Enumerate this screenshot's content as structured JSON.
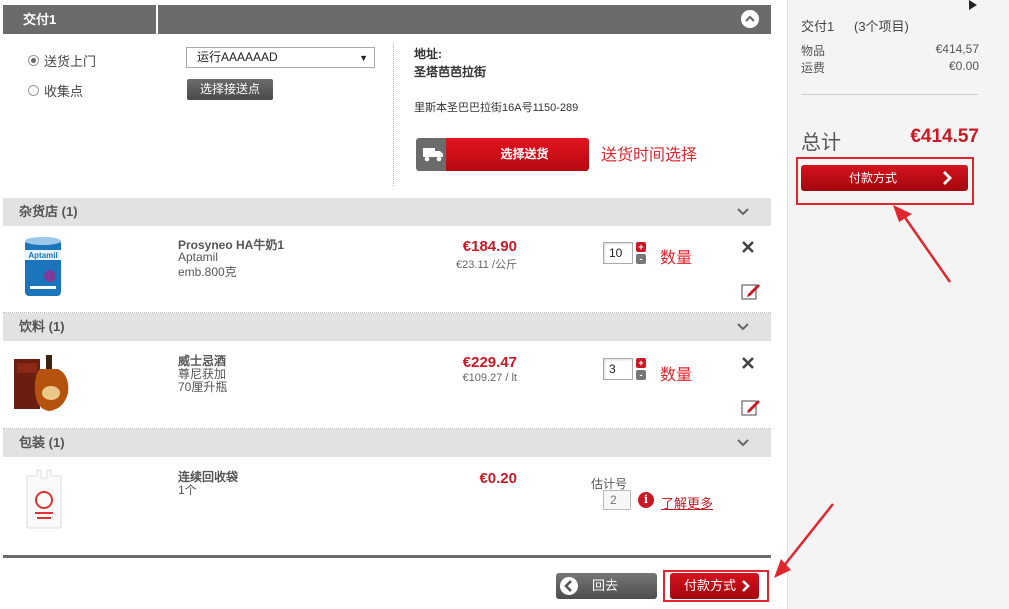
{
  "header": {
    "title": "交付1"
  },
  "delivery": {
    "option_home": "送货上门",
    "option_pickup": "收集点",
    "select_value": "运行AAAAAAD",
    "pickup_btn": "选择接送点",
    "address_label": "地址:",
    "address_name": "圣塔芭芭拉街",
    "address_line": "里斯本圣巴巴拉街16A号1150-289",
    "choose_delivery_btn": "选择送货",
    "delivery_time_annotation": "送货时间选择"
  },
  "sections": [
    {
      "name": "杂货店",
      "count": "(1)",
      "item": {
        "name": "Prosyneo HA牛奶1",
        "brand": "Aptamil",
        "detail": "emb.800克",
        "price": "€184.90",
        "unit": "€23.11 /公斤",
        "qty": "10",
        "qty_label": "数量",
        "image_label": "Aptamil"
      }
    },
    {
      "name": "饮料",
      "count": "(1)",
      "item": {
        "name": "威士忌酒",
        "brand": "尊尼获加",
        "detail": "70厘升瓶",
        "price": "€229.47",
        "unit": "€109.27 / lt",
        "qty": "3",
        "qty_label": "数量"
      }
    },
    {
      "name": "包装",
      "count": "(1)",
      "item": {
        "name": "连续回收袋",
        "brand": "1个",
        "price": "€0.20",
        "estimate_label": "估计号",
        "estimate_value": "2",
        "info_glyph": "i",
        "learn_more": "了解更多"
      }
    }
  ],
  "qty_controls": {
    "plus": "+",
    "minus": "-"
  },
  "footer": {
    "back_btn": "回去",
    "pay_btn": "付款方式"
  },
  "sidebar": {
    "title": "交付1",
    "count": "(3个项目)",
    "goods_label": "物品",
    "goods_value": "€414,57",
    "shipping_label": "运费",
    "shipping_value": "€0.00",
    "total_label": "总计",
    "total_value": "€414.57",
    "pay_btn": "付款方式"
  },
  "colors": {
    "accent": "#c81925",
    "annotation": "#e0262f",
    "header_bg": "#6b6b6b",
    "section_bg": "#e2e2e2"
  }
}
